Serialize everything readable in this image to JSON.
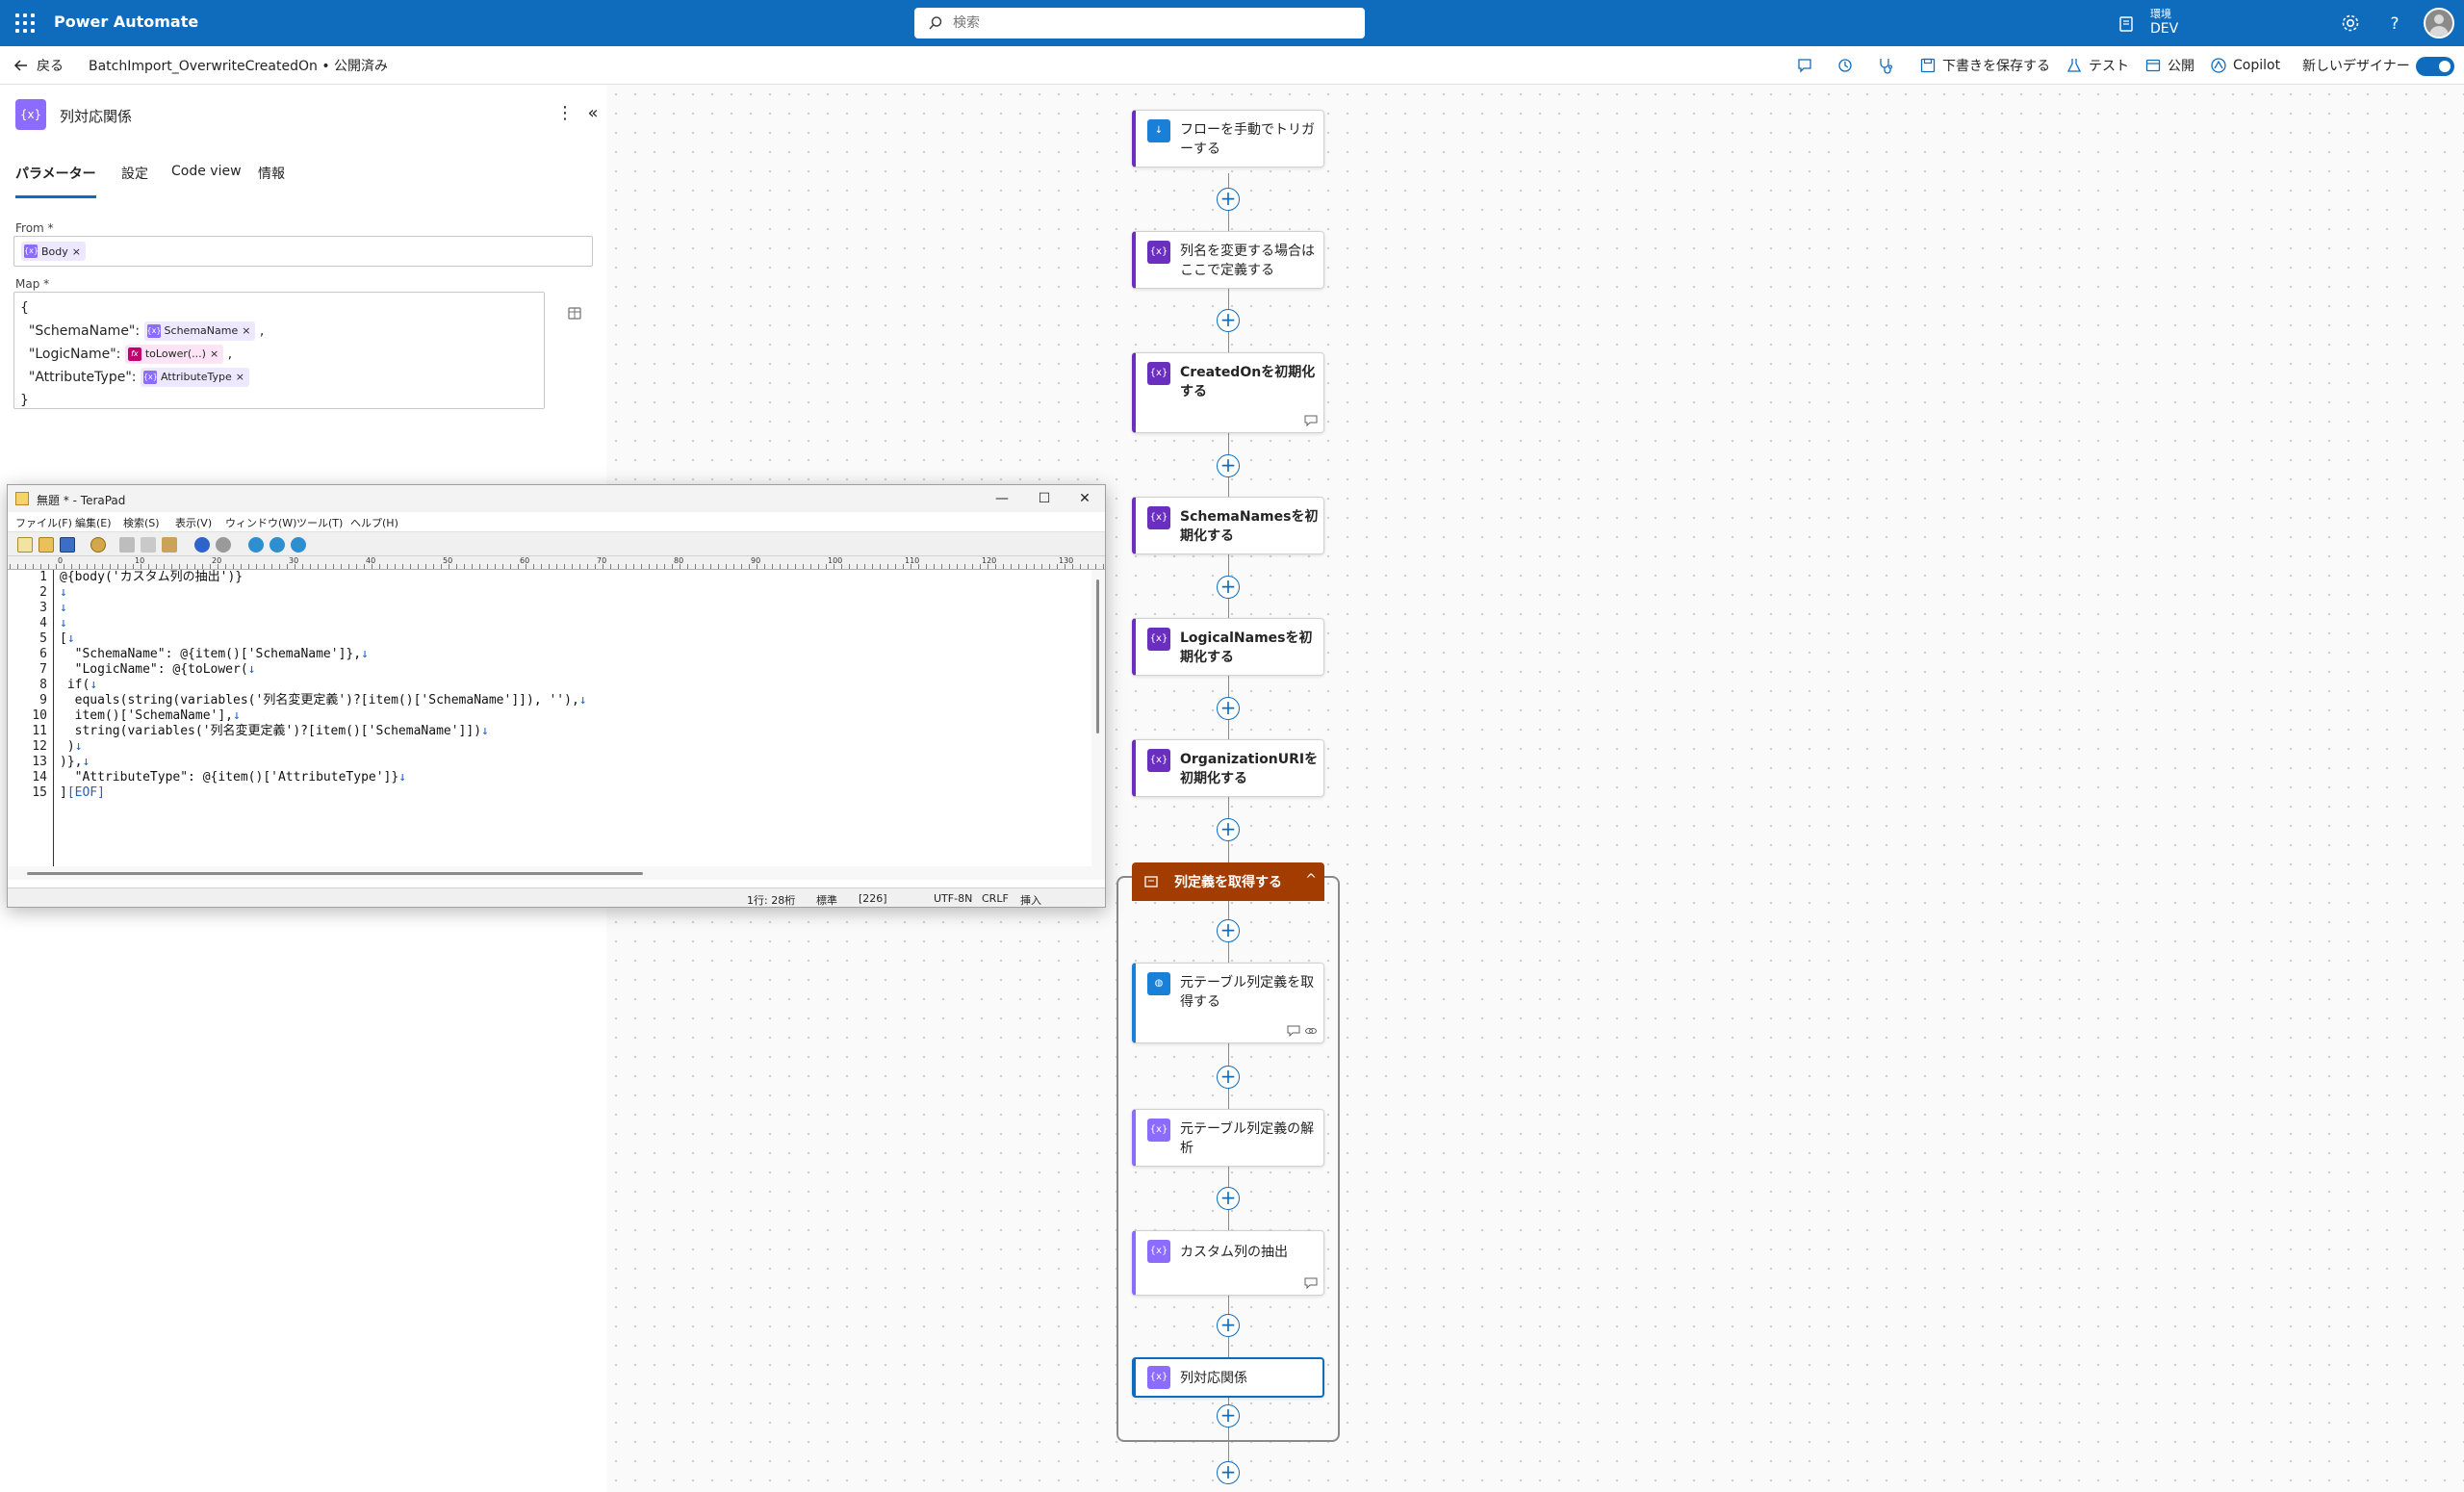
{
  "app": {
    "title": "Power Automate",
    "search_placeholder": "検索",
    "env_label": "環境",
    "env_name": "DEV",
    "brand_color": "#0f6cbd"
  },
  "cmdbar": {
    "back_label": "戻る",
    "breadcrumb": "BatchImport_OverwriteCreatedOn • 公開済み",
    "save_draft": "下書きを保存する",
    "test": "テスト",
    "publish": "公開",
    "copilot": "Copilot",
    "new_designer": "新しいデザイナー",
    "new_designer_on": true
  },
  "panel": {
    "title": "列対応関係",
    "icon": "variable-icon",
    "tabs": [
      "パラメーター",
      "設定",
      "Code view",
      "情報"
    ],
    "active_tab": "パラメーター",
    "from_label": "From *",
    "from_token": "Body",
    "map_label": "Map *",
    "map": {
      "open": "{",
      "close": "}",
      "rows": [
        {
          "key": "\"SchemaName\":",
          "token": "SchemaName",
          "fx": false,
          "suffix": ","
        },
        {
          "key": "\"LogicName\":",
          "token": "toLower(...)",
          "fx": true,
          "suffix": ","
        },
        {
          "key": "\"AttributeType\":",
          "token": "AttributeType",
          "fx": false,
          "suffix": ""
        }
      ]
    }
  },
  "flow": {
    "nodes": [
      {
        "label": "フローを手動でトリガーする",
        "icon": "trigger-icon"
      },
      {
        "label": "列名を変更する場合はここで定義する",
        "icon": "variable-icon"
      },
      {
        "label": "CreatedOnを初期化する",
        "icon": "variable-icon"
      },
      {
        "label": "SchemaNamesを初期化する",
        "icon": "variable-icon"
      },
      {
        "label": "LogicalNamesを初期化する",
        "icon": "variable-icon"
      },
      {
        "label": "OrganizationURIを初期化する",
        "icon": "variable-icon"
      }
    ],
    "scope_label": "列定義を取得する",
    "scope_color": "#a33c00",
    "scope_nodes": [
      {
        "label": "元テーブル列定義を取得する",
        "icon": "http-globe-icon"
      },
      {
        "label": "元テーブル列定義の解析",
        "icon": "parse-json-icon"
      },
      {
        "label": "カスタム列の抽出",
        "icon": "filter-array-icon"
      },
      {
        "label": "列対応関係",
        "icon": "select-icon"
      }
    ]
  },
  "terapad": {
    "title": "無題 * - TeraPad",
    "menu": [
      "ファイル(F)",
      "編集(E)",
      "検索(S)",
      "表示(V)",
      "ウィンドウ(W)",
      "ツール(T)",
      "ヘルプ(H)"
    ],
    "lines": [
      "@{body('カスタム列の抽出')}",
      "",
      "",
      "",
      "[",
      "  \"SchemaName\": @{item()['SchemaName']},",
      "  \"LogicName\": @{toLower(",
      " if(",
      "  equals(string(variables('列名変更定義')?[item()['SchemaName']]), ''),",
      "  item()['SchemaName'],",
      "  string(variables('列名変更定義')?[item()['SchemaName']])",
      " )",
      ")},",
      "  \"AttributeType\": @{item()['AttributeType']}",
      "]"
    ],
    "line_marks": [
      "",
      "↓",
      "↓",
      "↓",
      "↓",
      "↓",
      "↓",
      "↓",
      "↓",
      "↓",
      "↓",
      "↓",
      "↓",
      "↓",
      "[EOF]"
    ],
    "status": {
      "position": "1行: 28桁",
      "mode": "標準",
      "code": "[226]",
      "encoding": "UTF-8N",
      "newline": "CRLF",
      "insert": "挿入"
    },
    "ruler_marks": [
      "0",
      "10",
      "20",
      "30",
      "40",
      "50",
      "60",
      "70",
      "80",
      "90",
      "100",
      "110",
      "120",
      "130"
    ]
  }
}
